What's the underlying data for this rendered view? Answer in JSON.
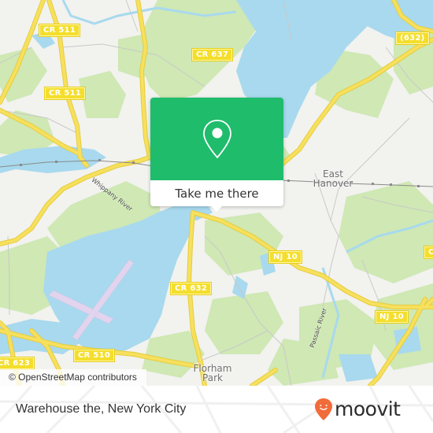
{
  "map": {
    "attribution": "© OpenStreetMap contributors",
    "colors": {
      "land": "#f2f2ef",
      "park": "#cfe8b4",
      "water": "#a8d9ee",
      "road_major": "#f6e05e",
      "road_outline": "#e7cc3a",
      "road_minor": "#c9c9c9",
      "rail": "#8a8a8a",
      "runway": "#e2d4ee"
    },
    "route_shields": [
      {
        "id": "cr511-top",
        "label": "CR 511"
      },
      {
        "id": "cr511-mid",
        "label": "CR 511"
      },
      {
        "id": "cr637",
        "label": "CR 637"
      },
      {
        "id": "r632-ne",
        "label": "(632)"
      },
      {
        "id": "nj10-center",
        "label": "NJ 10"
      },
      {
        "id": "nj10-east",
        "label": "NJ 10"
      },
      {
        "id": "cr632",
        "label": "CR 632"
      },
      {
        "id": "cr510",
        "label": "CR 510"
      },
      {
        "id": "cr623",
        "label": "CR 623"
      },
      {
        "id": "edge-right",
        "label": "C"
      }
    ],
    "places": [
      {
        "id": "east-hanover",
        "line1": "East",
        "line2": "Hanover"
      },
      {
        "id": "florham-park",
        "line1": "Florham",
        "line2": "Park"
      }
    ],
    "waterways": [
      {
        "id": "whippany-river",
        "label": "Whippany River"
      },
      {
        "id": "passaic-river",
        "label": "Passaic River"
      }
    ]
  },
  "popup": {
    "icon": "map-pin-icon",
    "cta_label": "Take me there",
    "accent": "#1fbc6c"
  },
  "footer": {
    "place_name": "Warehouse the, New York City",
    "brand": "moovit",
    "brand_icon": "moovit-smiley-pin-icon",
    "brand_color": "#f26b3a"
  }
}
